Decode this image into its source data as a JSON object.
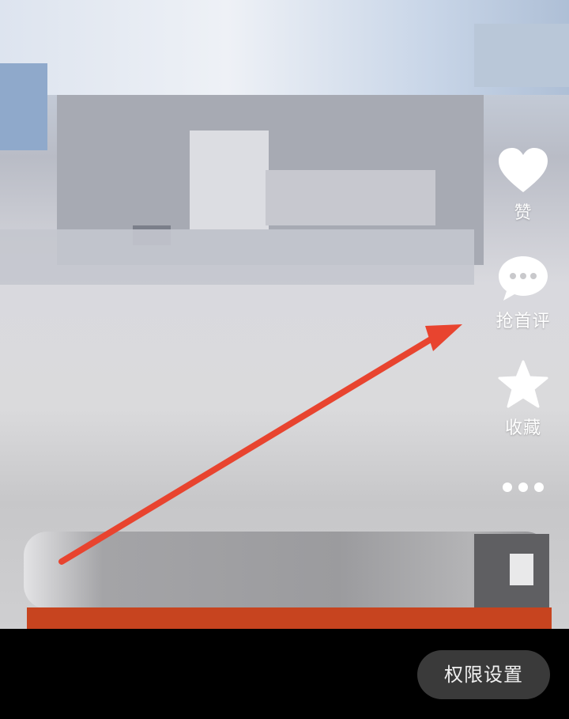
{
  "side_actions": [
    {
      "icon": "heart-icon",
      "label": "赞"
    },
    {
      "icon": "comment-icon",
      "label": "抢首评"
    },
    {
      "icon": "star-icon",
      "label": "收藏"
    },
    {
      "icon": "more-icon",
      "label": ""
    }
  ],
  "permission_button": {
    "label": "权限设置"
  },
  "colors": {
    "arrow": "#e8442f",
    "button_bg": "#3a3a3a"
  }
}
